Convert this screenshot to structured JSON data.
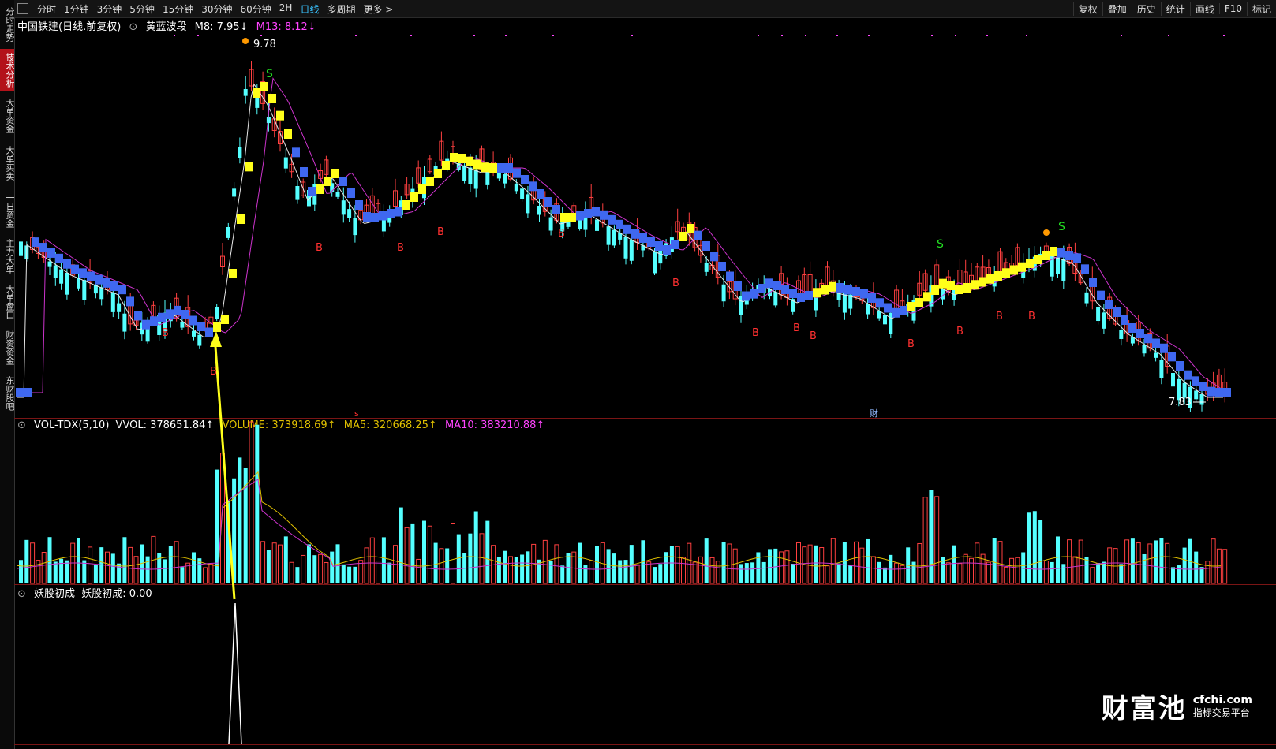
{
  "toolbar": {
    "tabs": [
      {
        "label": "分时",
        "active": false
      },
      {
        "label": "1分钟",
        "active": false
      },
      {
        "label": "3分钟",
        "active": false
      },
      {
        "label": "5分钟",
        "active": false
      },
      {
        "label": "15分钟",
        "active": false
      },
      {
        "label": "30分钟",
        "active": false
      },
      {
        "label": "60分钟",
        "active": false
      },
      {
        "label": "2H",
        "active": false
      },
      {
        "label": "日线",
        "active": true
      },
      {
        "label": "多周期",
        "active": false
      },
      {
        "label": "更多 >",
        "active": false
      }
    ],
    "right_buttons": [
      "复权",
      "叠加",
      "历史",
      "统计",
      "画线",
      "F10",
      "标记"
    ]
  },
  "sidebar": {
    "items": [
      {
        "label": "分时走势",
        "active": false
      },
      {
        "label": "技术分析",
        "active": true
      },
      {
        "label": "大单资金",
        "active": false
      },
      {
        "label": "大单买卖",
        "active": false
      },
      {
        "label": "一日资金",
        "active": false
      },
      {
        "label": "主力大单",
        "active": false
      },
      {
        "label": "大单盘口",
        "active": false
      },
      {
        "label": "财资资金",
        "active": false
      },
      {
        "label": "东财股吧",
        "active": false
      }
    ]
  },
  "main_legend": {
    "title": "中国铁建(日线.前复权)",
    "indicator": "黄蓝波段",
    "m8": "M8: 7.95↓",
    "m13": "M13: 8.12↓"
  },
  "annotations": {
    "high": "9.78",
    "low": "7.83",
    "finance_mark": "财",
    "s_mark": "S",
    "b_mark": "B",
    "red_s": "s"
  },
  "vol_legend": {
    "name": "VOL-TDX(5,10)",
    "vvol": "VVOL: 378651.84↑",
    "volume": "VOLUME: 373918.69↑",
    "ma5": "MA5: 320668.25↑",
    "ma10": "MA10: 383210.88↑"
  },
  "yao_legend": {
    "name": "妖股初成",
    "value": "妖股初成: 0.00"
  },
  "watermark": {
    "brand": "财富池",
    "domain": "cfchi.com",
    "slogan": "指标交易平台"
  },
  "colors": {
    "up": "#ff4040",
    "down": "#54ffff",
    "yellow": "#ffff1a",
    "blue": "#3f68f0",
    "magenta": "#cc33cc",
    "white": "#e8e8e8"
  }
}
